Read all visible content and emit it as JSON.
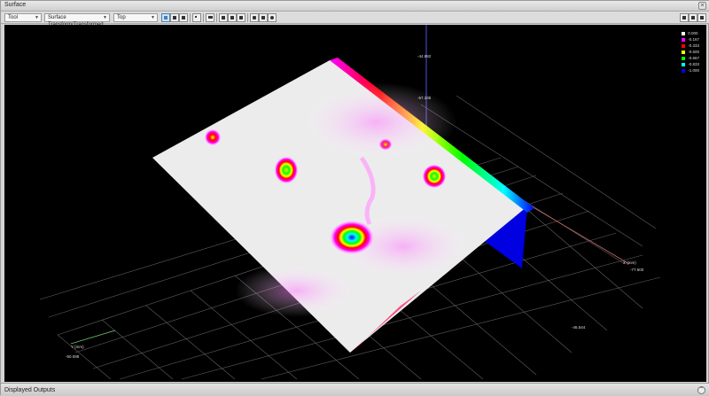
{
  "window": {
    "title": "Surface",
    "close_glyph": "×"
  },
  "toolbar": {
    "tool_select": "Tool",
    "output_select": "Surface Transform/Transformed",
    "view_select": "Top"
  },
  "legend": {
    "entries": [
      {
        "label": "0.000",
        "color": "#ffffff"
      },
      {
        "label": "-0.167",
        "color": "#ff00ff"
      },
      {
        "label": "-0.333",
        "color": "#ff0000"
      },
      {
        "label": "-0.500",
        "color": "#ffff00"
      },
      {
        "label": "-0.667",
        "color": "#00ff00"
      },
      {
        "label": "-0.833",
        "color": "#00ffff"
      },
      {
        "label": "-1.000",
        "color": "#0000ff"
      }
    ]
  },
  "axes": {
    "z_top": "-44.882",
    "z_mid": "-67.335",
    "x_label": "X (mm)",
    "x_value": "-77.600",
    "y_label": "Y (mm)",
    "y_value": "-50.088",
    "x_bottom": "-46.544"
  },
  "bottom_panel": {
    "title": "Displayed Outputs",
    "expand_glyph": "⌃"
  },
  "icons": [
    "close-icon",
    "display-mode-icon",
    "tile-icon",
    "window-icon",
    "grid-icon",
    "hand-icon",
    "zoom-icon",
    "expand-icon"
  ],
  "colors": {
    "accent": "#4a7fb5",
    "viewport_bg": "#000000",
    "grid": "#6a6a6a"
  }
}
